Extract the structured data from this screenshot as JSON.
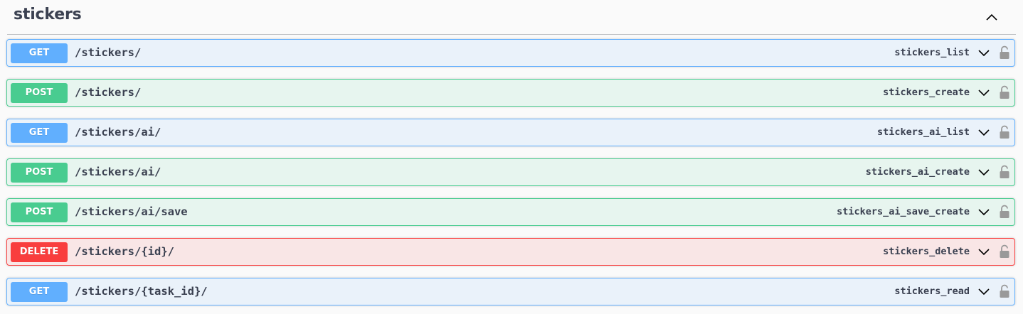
{
  "section": {
    "title": "stickers"
  },
  "operations": [
    {
      "method": "GET",
      "path": "/stickers/",
      "operation_id": "stickers_list"
    },
    {
      "method": "POST",
      "path": "/stickers/",
      "operation_id": "stickers_create"
    },
    {
      "method": "GET",
      "path": "/stickers/ai/",
      "operation_id": "stickers_ai_list"
    },
    {
      "method": "POST",
      "path": "/stickers/ai/",
      "operation_id": "stickers_ai_create"
    },
    {
      "method": "POST",
      "path": "/stickers/ai/save",
      "operation_id": "stickers_ai_save_create"
    },
    {
      "method": "DELETE",
      "path": "/stickers/{id}/",
      "operation_id": "stickers_delete"
    },
    {
      "method": "GET",
      "path": "/stickers/{task_id}/",
      "operation_id": "stickers_read"
    }
  ],
  "colors": {
    "get": "#61affe",
    "post": "#49cc90",
    "delete": "#f93e3e",
    "text": "#3b4151"
  },
  "icons": {
    "section_toggle": "chevron-up-icon",
    "operation_toggle": "chevron-down-icon",
    "auth": "lock-icon"
  }
}
